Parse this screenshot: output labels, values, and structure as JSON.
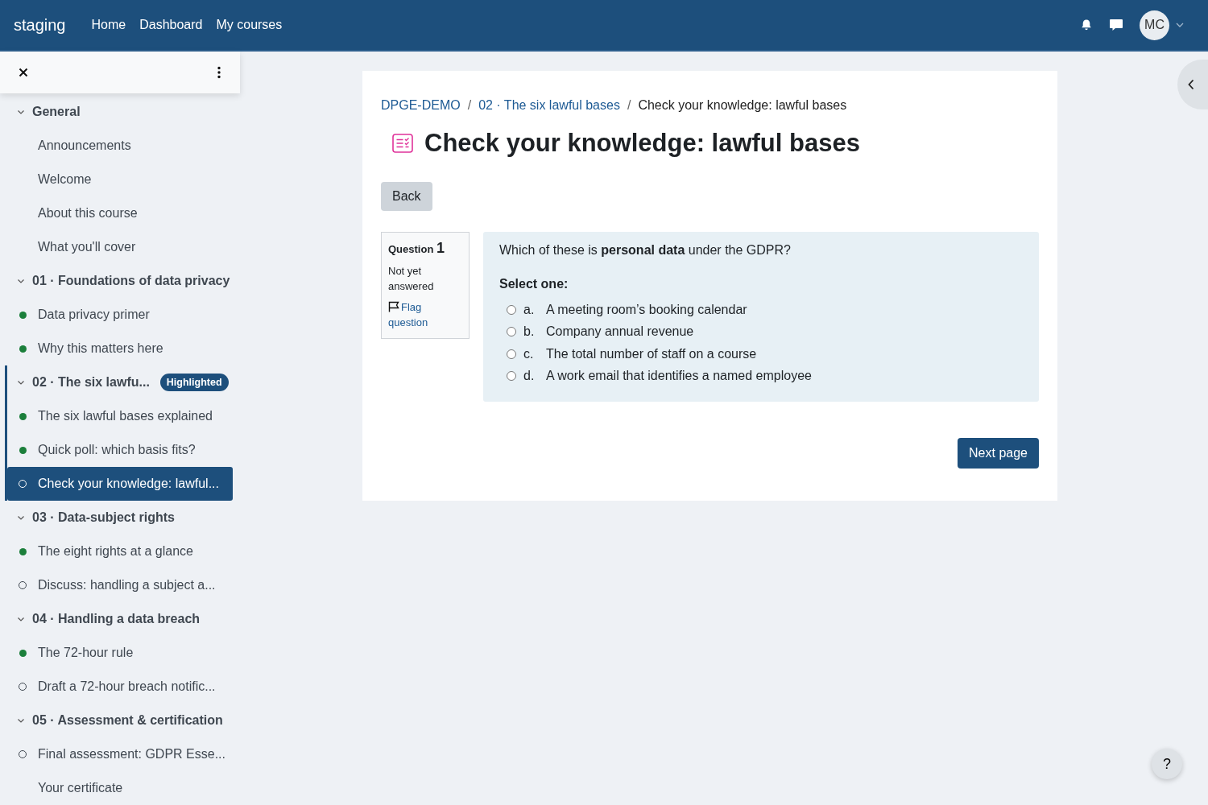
{
  "navbar": {
    "brand": "staging",
    "links": [
      "Home",
      "Dashboard",
      "My courses"
    ],
    "avatar": "MC"
  },
  "sidebar": {
    "sections": [
      {
        "title": "General",
        "expanded": true,
        "highlighted": false,
        "children": [
          {
            "title": "Announcements",
            "kind": "plain",
            "selected": false
          },
          {
            "title": "Welcome",
            "kind": "plain",
            "selected": false
          },
          {
            "title": "About this course",
            "kind": "plain",
            "selected": false
          },
          {
            "title": "What you'll cover",
            "kind": "plain",
            "selected": false
          }
        ]
      },
      {
        "title": "01 · Foundations of data privacy",
        "expanded": true,
        "highlighted": false,
        "children": [
          {
            "title": "Data privacy primer",
            "kind": "complete",
            "selected": false
          },
          {
            "title": "Why this matters here",
            "kind": "complete",
            "selected": false
          }
        ]
      },
      {
        "title": "02 · The six lawfu...",
        "expanded": true,
        "highlighted": true,
        "badge": "Highlighted",
        "children": [
          {
            "title": "The six lawful bases explained",
            "kind": "complete",
            "selected": false
          },
          {
            "title": "Quick poll: which basis fits?",
            "kind": "complete",
            "selected": false
          },
          {
            "title": "Check your knowledge: lawful...",
            "kind": "incomplete",
            "selected": true
          }
        ]
      },
      {
        "title": "03 · Data-subject rights",
        "expanded": true,
        "highlighted": false,
        "children": [
          {
            "title": "The eight rights at a glance",
            "kind": "complete",
            "selected": false
          },
          {
            "title": "Discuss: handling a subject a...",
            "kind": "incomplete",
            "selected": false
          }
        ]
      },
      {
        "title": "04 · Handling a data breach",
        "expanded": true,
        "highlighted": false,
        "children": [
          {
            "title": "The 72-hour rule",
            "kind": "complete",
            "selected": false
          },
          {
            "title": "Draft a 72-hour breach notific...",
            "kind": "incomplete",
            "selected": false
          }
        ]
      },
      {
        "title": "05 · Assessment & certification",
        "expanded": true,
        "highlighted": false,
        "children": [
          {
            "title": "Final assessment: GDPR Esse...",
            "kind": "incomplete",
            "selected": false
          },
          {
            "title": "Your certificate",
            "kind": "plain",
            "selected": false
          }
        ]
      }
    ]
  },
  "breadcrumb": [
    {
      "text": "DPGE-DEMO",
      "kind": "link"
    },
    {
      "text": "/",
      "kind": "separator"
    },
    {
      "text": "02 · The six lawful bases",
      "kind": "link"
    },
    {
      "text": "/",
      "kind": "separator"
    },
    {
      "text": "Check your knowledge: lawful bases",
      "kind": "current"
    }
  ],
  "title": "Check your knowledge: lawful bases",
  "back_button": "Back",
  "question": {
    "label": "Question",
    "number": "1",
    "state": "Not yet answered",
    "flag": "Flag question",
    "text": "Which of these is **personal data** under the GDPR?",
    "prompt": "Select one:",
    "options": [
      {
        "letter": "a.",
        "text": "A meeting room’s booking calendar",
        "selected": false
      },
      {
        "letter": "b.",
        "text": "Company annual revenue",
        "selected": false
      },
      {
        "letter": "c.",
        "text": "The total number of staff on a course",
        "selected": false
      },
      {
        "letter": "d.",
        "text": "A work email that identifies a named employee",
        "selected": false
      }
    ]
  },
  "next_button": "Next page",
  "help_button": "?"
}
